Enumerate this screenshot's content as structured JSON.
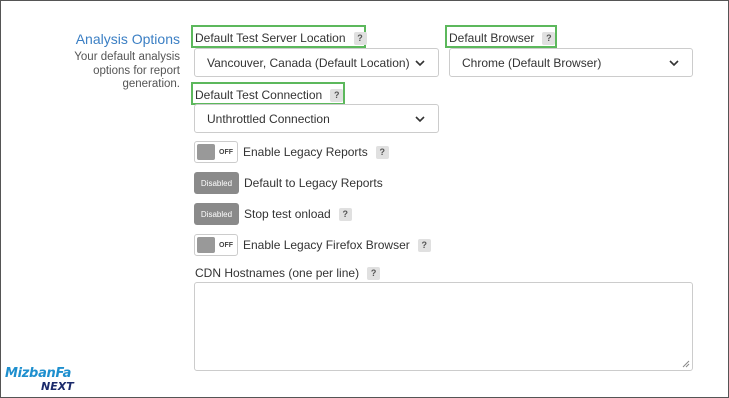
{
  "section": {
    "title": "Analysis Options",
    "description": "Your default analysis options for report generation."
  },
  "server_location": {
    "label": "Default Test Server Location",
    "help": "?",
    "value": "Vancouver, Canada (Default Location)"
  },
  "browser": {
    "label": "Default Browser",
    "help": "?",
    "value": "Chrome (Default Browser)"
  },
  "connection": {
    "label": "Default Test Connection",
    "help": "?",
    "value": "Unthrottled Connection"
  },
  "toggles": [
    {
      "state": "OFF",
      "label": "Enable Legacy Reports",
      "help": "?"
    },
    {
      "state": "Disabled",
      "label": "Default to Legacy Reports"
    },
    {
      "state": "Disabled",
      "label": "Stop test onload",
      "help": "?"
    },
    {
      "state": "OFF",
      "label": "Enable Legacy Firefox Browser",
      "help": "?"
    }
  ],
  "cdn": {
    "label": "CDN Hostnames (one per line)",
    "help": "?",
    "value": ""
  },
  "logo": {
    "main": "MizbanFa",
    "sub": "NEXT"
  },
  "colors": {
    "accent": "#3b7fc4",
    "highlight": "#5cb85c",
    "disabled": "#8a8a8a"
  }
}
